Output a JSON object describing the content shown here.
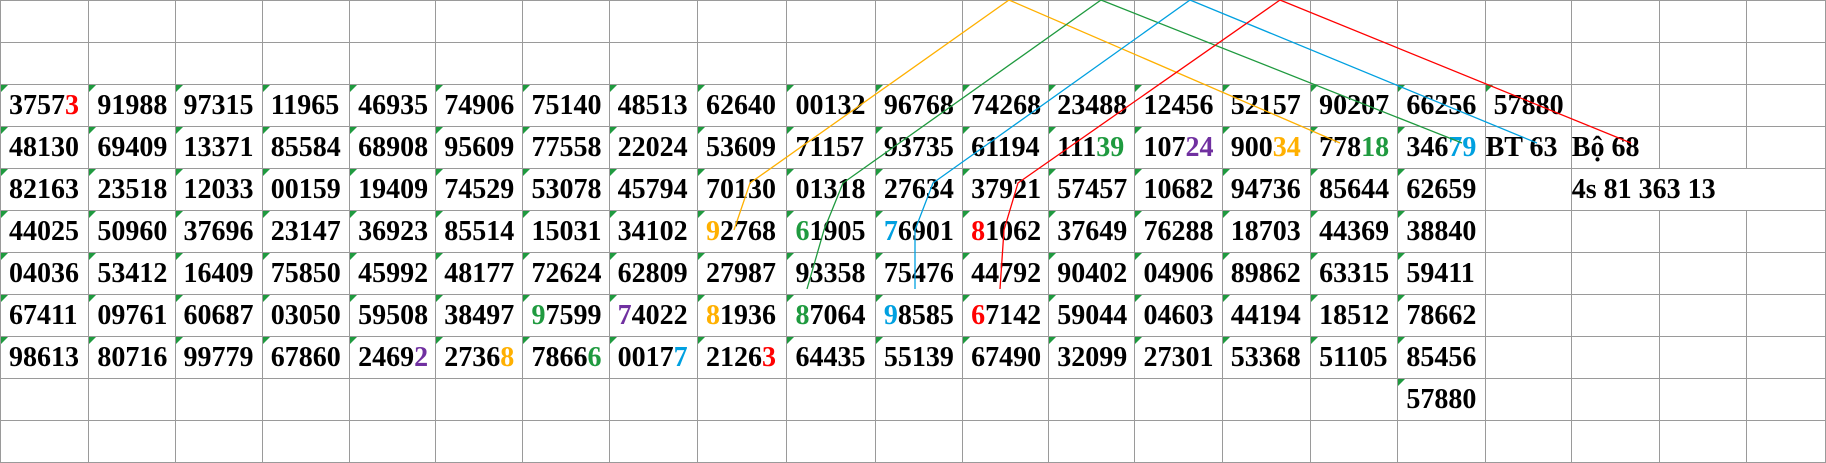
{
  "colors": {
    "red": "#ff0000",
    "green": "#1f9a3f",
    "orange": "#ffb000",
    "purple": "#7030a0",
    "blue": "#00a0e0",
    "grid_line": "#9a9a9a"
  },
  "rows": [
    [
      {
        "t": "37573",
        "hi": 1,
        "c": "red"
      },
      {
        "t": "91988"
      },
      {
        "t": "97315"
      },
      {
        "t": "11965"
      },
      {
        "t": "46935"
      },
      {
        "t": "74906"
      },
      {
        "t": "75140"
      },
      {
        "t": "48513"
      },
      {
        "t": "62640"
      },
      {
        "t": "00132"
      },
      {
        "t": "96768"
      },
      {
        "t": "74268"
      },
      {
        "t": "23488"
      },
      {
        "t": "12456"
      },
      {
        "t": "52157"
      },
      {
        "t": "90207"
      },
      {
        "t": "66256"
      },
      {
        "t": "57880"
      }
    ],
    [
      {
        "t": "48130"
      },
      {
        "t": "69409"
      },
      {
        "t": "13371"
      },
      {
        "t": "85584"
      },
      {
        "t": "68908"
      },
      {
        "t": "95609"
      },
      {
        "t": "77558"
      },
      {
        "t": "22024"
      },
      {
        "t": "53609"
      },
      {
        "t": "71157"
      },
      {
        "t": "93735"
      },
      {
        "t": "61194"
      },
      {
        "t": "11139",
        "hi": 2,
        "c": "green"
      },
      {
        "t": "10724",
        "hi": 2,
        "c": "purple"
      },
      {
        "t": "90034",
        "hi": 2,
        "c": "orange"
      },
      {
        "t": "77818",
        "hi": 2,
        "c": "green"
      },
      {
        "t": "34679",
        "hi": 2,
        "c": "blue"
      }
    ],
    [
      {
        "t": "82163"
      },
      {
        "t": "23518"
      },
      {
        "t": "12033"
      },
      {
        "t": "00159"
      },
      {
        "t": "19409"
      },
      {
        "t": "74529"
      },
      {
        "t": "53078"
      },
      {
        "t": "45794"
      },
      {
        "t": "70130"
      },
      {
        "t": "01318"
      },
      {
        "t": "27634"
      },
      {
        "t": "37921"
      },
      {
        "t": "57457"
      },
      {
        "t": "10682"
      },
      {
        "t": "94736"
      },
      {
        "t": "85644"
      },
      {
        "t": "62659"
      }
    ],
    [
      {
        "t": "44025"
      },
      {
        "t": "50960"
      },
      {
        "t": "37696"
      },
      {
        "t": "23147"
      },
      {
        "t": "36923"
      },
      {
        "t": "85514"
      },
      {
        "t": "15031"
      },
      {
        "t": "34102"
      },
      {
        "t": "92768",
        "hi": 0,
        "c": "orange"
      },
      {
        "t": "61905",
        "hi": 0,
        "c": "green"
      },
      {
        "t": "76901",
        "hi": 0,
        "c": "blue"
      },
      {
        "t": "81062",
        "hi": 0,
        "c": "red"
      },
      {
        "t": "37649"
      },
      {
        "t": "76288"
      },
      {
        "t": "18703"
      },
      {
        "t": "44369"
      },
      {
        "t": "38840"
      }
    ],
    [
      {
        "t": "04036"
      },
      {
        "t": "53412"
      },
      {
        "t": "16409"
      },
      {
        "t": "75850"
      },
      {
        "t": "45992"
      },
      {
        "t": "48177"
      },
      {
        "t": "72624"
      },
      {
        "t": "62809"
      },
      {
        "t": "27987"
      },
      {
        "t": "93358"
      },
      {
        "t": "75476"
      },
      {
        "t": "44792"
      },
      {
        "t": "90402"
      },
      {
        "t": "04906"
      },
      {
        "t": "89862"
      },
      {
        "t": "63315"
      },
      {
        "t": "59411"
      }
    ],
    [
      {
        "t": "67411"
      },
      {
        "t": "09761"
      },
      {
        "t": "60687"
      },
      {
        "t": "03050"
      },
      {
        "t": "59508"
      },
      {
        "t": "38497"
      },
      {
        "t": "97599",
        "hi": 0,
        "c": "green"
      },
      {
        "t": "74022",
        "hi": 0,
        "c": "purple"
      },
      {
        "t": "81936",
        "hi": 0,
        "c": "orange"
      },
      {
        "t": "87064",
        "hi": 0,
        "c": "green"
      },
      {
        "t": "98585",
        "hi": 0,
        "c": "blue"
      },
      {
        "t": "67142",
        "hi": 0,
        "c": "red"
      },
      {
        "t": "59044"
      },
      {
        "t": "04603"
      },
      {
        "t": "44194"
      },
      {
        "t": "18512"
      },
      {
        "t": "78662"
      }
    ],
    [
      {
        "t": "98613"
      },
      {
        "t": "80716"
      },
      {
        "t": "99779"
      },
      {
        "t": "67860"
      },
      {
        "t": "24692",
        "hi": 4,
        "c": "purple"
      },
      {
        "t": "27368",
        "hi": 4,
        "c": "orange"
      },
      {
        "t": "78666",
        "hi": 4,
        "c": "green"
      },
      {
        "t": "00177",
        "hi": 4,
        "c": "blue"
      },
      {
        "t": "21263",
        "hi": 4,
        "c": "red"
      },
      {
        "t": "64435"
      },
      {
        "t": "55139"
      },
      {
        "t": "67490"
      },
      {
        "t": "32099"
      },
      {
        "t": "27301"
      },
      {
        "t": "53368"
      },
      {
        "t": "51105"
      },
      {
        "t": "85456"
      }
    ],
    [
      {
        "col": 16,
        "t": "57880"
      }
    ]
  ],
  "notes": {
    "bt": "BT 63",
    "bo": "Bộ 68",
    "fours": "4s 81 363 13"
  }
}
